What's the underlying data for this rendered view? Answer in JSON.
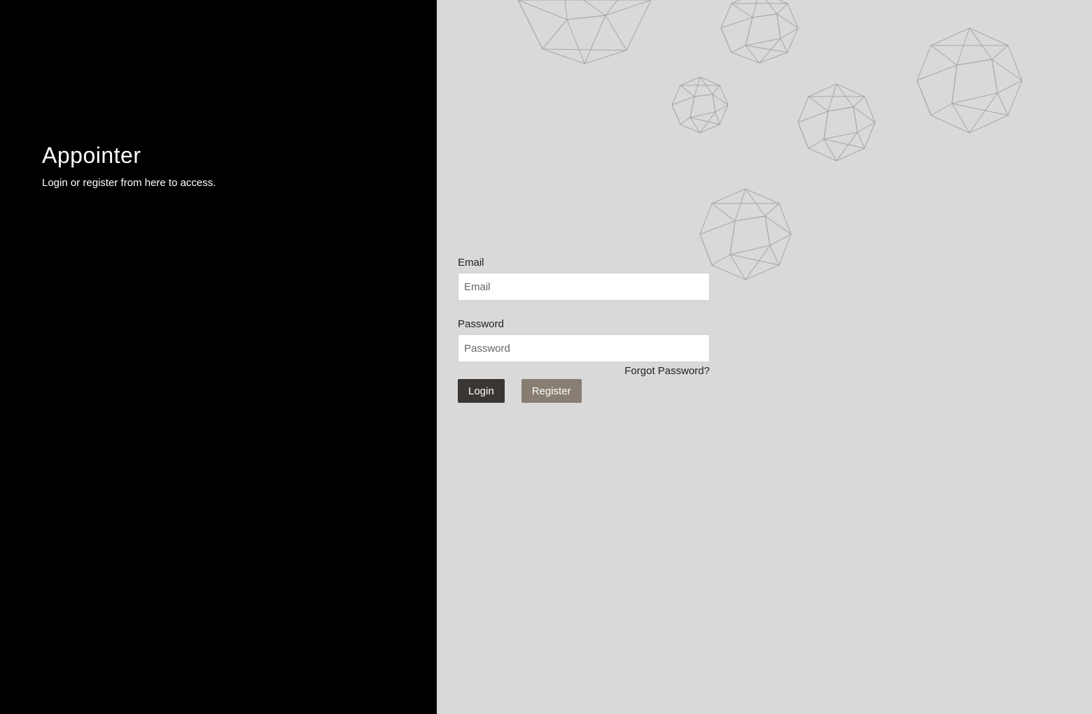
{
  "brand": {
    "title": "Appointer",
    "subtitle": "Login or register from here to access."
  },
  "form": {
    "email_label": "Email",
    "email_placeholder": "Email",
    "email_value": "",
    "password_label": "Password",
    "password_placeholder": "Password",
    "password_value": "",
    "forgot_label": "Forgot Password?",
    "login_label": "Login",
    "register_label": "Register"
  },
  "colors": {
    "left_background": "#000000",
    "right_background": "#d9d9d9",
    "login_button": "#3a3633",
    "register_button": "#877d72",
    "shape_stroke": "#a9a6a1"
  },
  "icons": [
    "geodesic-sphere-icon"
  ]
}
